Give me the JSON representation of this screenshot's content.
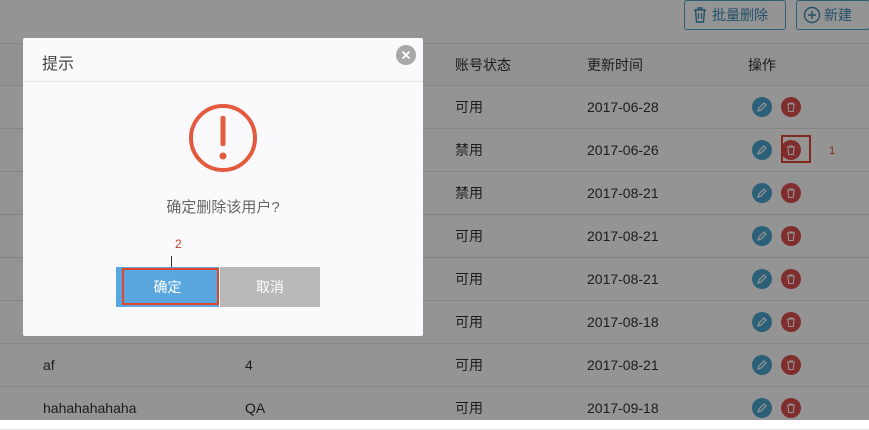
{
  "toolbar": {
    "batch_delete_label": "批量删除",
    "new_label": "新建"
  },
  "table": {
    "headers": {
      "status": "账号状态",
      "updated": "更新时间",
      "actions": "操作"
    },
    "rows": [
      {
        "name": "",
        "group": "",
        "status": "可用",
        "updated": "2017-06-28"
      },
      {
        "name": "",
        "group": "",
        "status": "禁用",
        "updated": "2017-06-26"
      },
      {
        "name": "",
        "group": "",
        "status": "禁用",
        "updated": "2017-08-21"
      },
      {
        "name": "",
        "group": "",
        "status": "可用",
        "updated": "2017-08-21"
      },
      {
        "name": "",
        "group": "",
        "status": "可用",
        "updated": "2017-08-21"
      },
      {
        "name": "",
        "group": "",
        "status": "可用",
        "updated": "2017-08-18"
      },
      {
        "name": "af",
        "group": "4",
        "status": "可用",
        "updated": "2017-08-21"
      },
      {
        "name": "hahahahahaha",
        "group": "QA",
        "status": "可用",
        "updated": "2017-09-18"
      }
    ]
  },
  "annotations": {
    "mark1": "1",
    "mark2": "2"
  },
  "modal": {
    "title": "提示",
    "message": "确定删除该用户?",
    "confirm_label": "确定",
    "cancel_label": "取消",
    "icon": "exclamation-circle-icon"
  },
  "colors": {
    "primary": "#5aa7df",
    "danger": "#dd4e4e",
    "alert": "#e45a3e",
    "highlight": "#e0452e",
    "cancel": "#b9b9b9"
  }
}
